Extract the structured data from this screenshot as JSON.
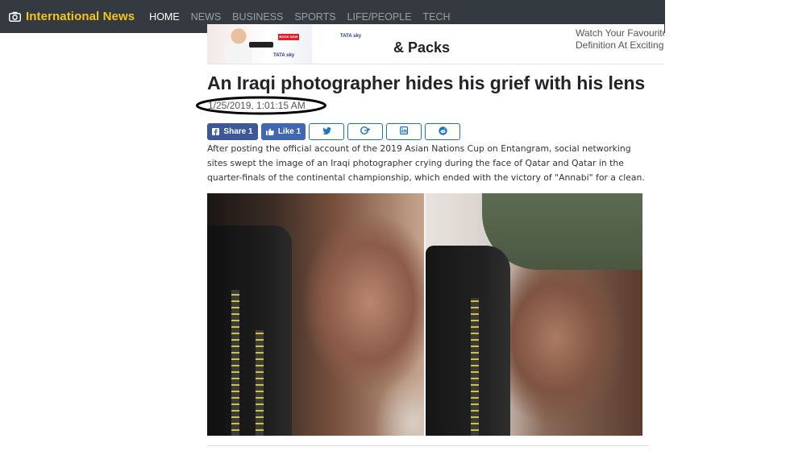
{
  "navbar": {
    "brand_icon": "camera-icon",
    "brand": "International News",
    "brand_color": "#f5c518",
    "background": "#343a40",
    "items": [
      {
        "label": "HOME",
        "active": true
      },
      {
        "label": "NEWS",
        "active": false
      },
      {
        "label": "BUSINESS",
        "active": false
      },
      {
        "label": "SPORTS",
        "active": false
      },
      {
        "label": "LIFE/PEOPLE",
        "active": false
      },
      {
        "label": "TECH",
        "active": false
      }
    ]
  },
  "ad": {
    "book_now": "BOOK NOW",
    "brand_small_1": "TATA sky",
    "brand_small_2": "TATA sky",
    "headline": "& Packs",
    "right_line_1": "Watch Your Favourite",
    "right_line_2": "Definition At Exciting"
  },
  "article": {
    "headline": "An Iraqi photographer hides his grief with his lens",
    "timestamp": "1/25/2019, 1:01:15 AM",
    "lead": "After posting the official account of the 2019 Asian Nations Cup on Entangram, social networking sites swept the image of an Iraqi photographer crying during the face of Qatar and Qatar in the quarter-finals of the continental championship, which ended with the victory of \"Annabi\" for a clean."
  },
  "share": {
    "facebook_label": "Share 1",
    "facebook_icon": "facebook-icon",
    "like_label": "Like 1",
    "like_icon": "thumbs-up-icon",
    "outline_icons": [
      "twitter-icon",
      "google-plus-icon",
      "linkedin-icon",
      "reddit-icon"
    ],
    "facebook_color": "#3b5998",
    "outline_color": "#1a73c6"
  }
}
